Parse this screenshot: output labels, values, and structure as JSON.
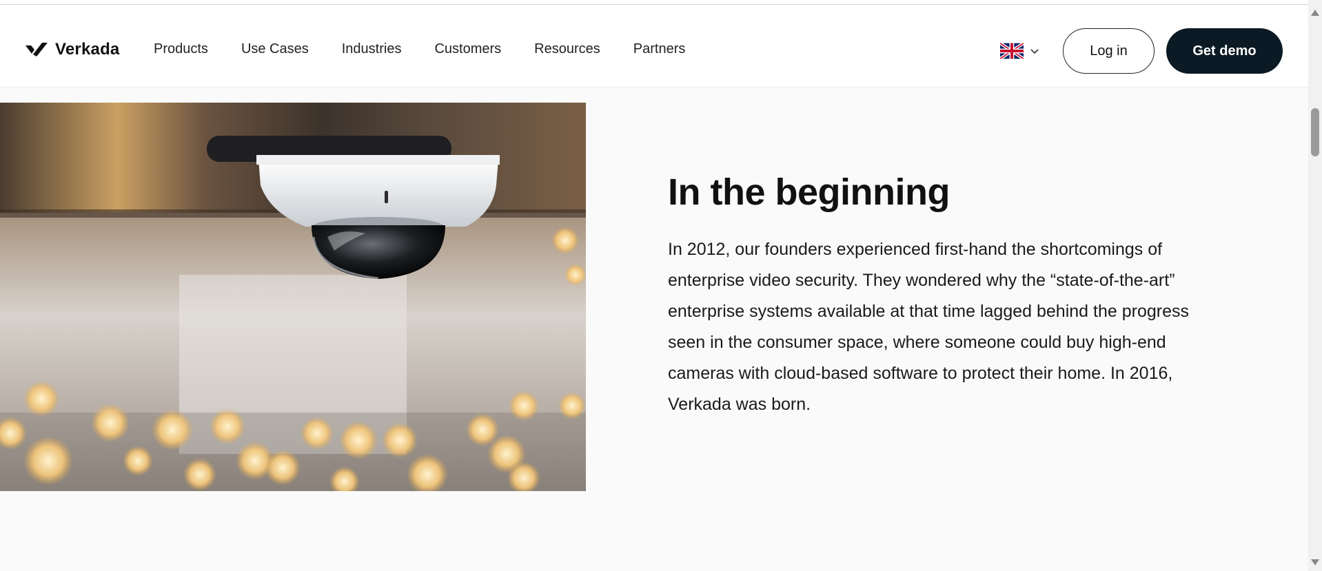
{
  "brand": {
    "name": "Verkada"
  },
  "nav": {
    "items": [
      "Products",
      "Use Cases",
      "Industries",
      "Customers",
      "Resources",
      "Partners"
    ]
  },
  "header_actions": {
    "language_icon": "uk-flag-icon",
    "login_label": "Log in",
    "demo_label": "Get demo"
  },
  "section": {
    "heading": "In the beginning",
    "body": "In 2012, our founders experienced first-hand the shortcomings of enterprise video security. They wondered why the “state-of-the-art” enterprise systems available at that time lagged behind the progress seen in the consumer space, where someone could buy high-end cameras with cloud-based software to protect their home. In 2016, Verkada was born."
  },
  "colors": {
    "demo_button_bg": "#0b1a24",
    "page_bg": "#fafafa"
  }
}
